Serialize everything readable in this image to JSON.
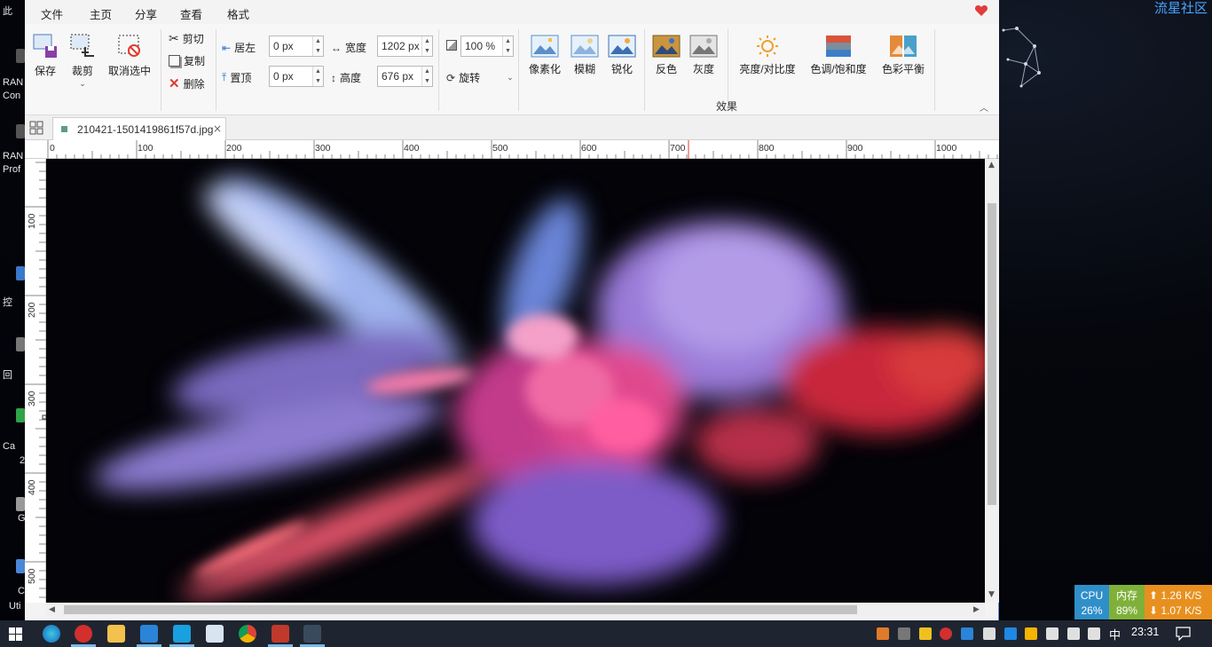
{
  "desktop": {
    "brand": "流星社区",
    "labels": [
      "此",
      "RAN",
      "Con",
      "RAN",
      "Prof",
      "控",
      "回",
      "Ca",
      "2",
      "G",
      "C",
      "Uti"
    ]
  },
  "app": {
    "menu": {
      "tabs": [
        "文件",
        "主页",
        "分享",
        "查看",
        "格式"
      ],
      "active": "格式"
    },
    "ribbon": {
      "save": "保存",
      "crop": "裁剪",
      "deselect": "取消选中",
      "cut": "剪切",
      "copy": "复制",
      "delete": "删除",
      "left_label": "居左",
      "left_value": "0 px",
      "top_label": "置顶",
      "top_value": "0 px",
      "width_label": "宽度",
      "width_value": "1202 px",
      "height_label": "高度",
      "height_value": "676 px",
      "zoom_value": "100 %",
      "rotate": "旋转",
      "effects": [
        "像素化",
        "模糊",
        "锐化",
        "反色",
        "灰度",
        "亮度/对比度",
        "色调/饱和度",
        "色彩平衡"
      ],
      "group_label": "效果"
    },
    "doc_tab": {
      "filename": "210421-1501419861f57d.jpg",
      "close": "×"
    },
    "ruler_h": [
      "0",
      "100",
      "200",
      "300",
      "400",
      "500",
      "600",
      "700",
      "800",
      "900",
      "1000"
    ],
    "ruler_v": [
      "100",
      "200",
      "300",
      "400",
      "500"
    ]
  },
  "monitor": {
    "cpu_label": "CPU",
    "cpu_value": "26%",
    "mem_label": "内存",
    "mem_value": "89%",
    "up": "1.26 K/S",
    "down": "1.07 K/S"
  },
  "taskbar": {
    "ime": "中",
    "time": "23:31"
  },
  "colors": {
    "accent": "#2b6fd6",
    "cpu_bg": "#2f8fc9",
    "mem_bg": "#7fb13a",
    "net_bg": "#e8901f",
    "heart": "#e23b3b"
  }
}
